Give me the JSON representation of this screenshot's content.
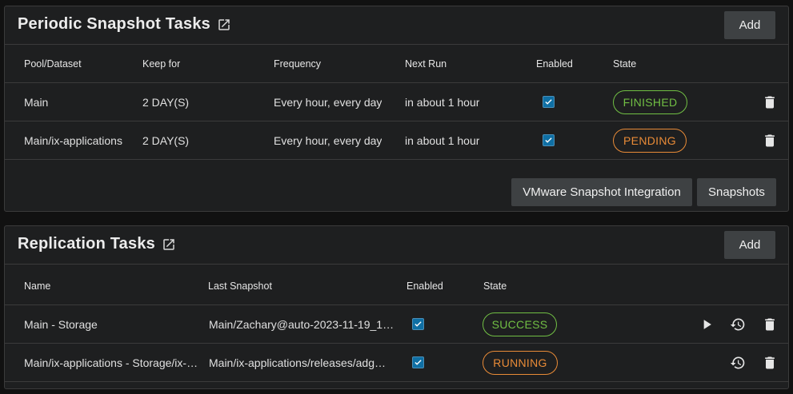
{
  "snapshot": {
    "title": "Periodic Snapshot Tasks",
    "add_label": "Add",
    "columns": [
      "Pool/Dataset",
      "Keep for",
      "Frequency",
      "Next Run",
      "Enabled",
      "State"
    ],
    "rows": [
      {
        "dataset": "Main",
        "keep": "2 DAY(S)",
        "frequency": "Every hour, every day",
        "next_run": "in about 1 hour",
        "enabled": true,
        "state": "FINISHED"
      },
      {
        "dataset": "Main/ix-applications",
        "keep": "2 DAY(S)",
        "frequency": "Every hour, every day",
        "next_run": "in about 1 hour",
        "enabled": true,
        "state": "PENDING"
      }
    ],
    "vmware_label": "VMware Snapshot Integration",
    "snapshots_label": "Snapshots"
  },
  "replication": {
    "title": "Replication Tasks",
    "add_label": "Add",
    "columns": [
      "Name",
      "Last Snapshot",
      "Enabled",
      "State"
    ],
    "rows": [
      {
        "name": "Main - Storage",
        "last_snapshot": "Main/Zachary@auto-2023-11-19_1…",
        "enabled": true,
        "state": "SUCCESS"
      },
      {
        "name": "Main/ix-applications - Storage/ix-…",
        "last_snapshot": "Main/ix-applications/releases/adg…",
        "enabled": true,
        "state": "RUNNING"
      }
    ]
  },
  "colors": {
    "success": "#71bf44",
    "warning": "#e98b37",
    "checkbox": "#0f6fa4",
    "button": "#3e4143"
  },
  "icons": [
    "open-in-new-icon",
    "checkbox-checked-icon",
    "delete-icon",
    "play-icon",
    "restore-icon"
  ]
}
